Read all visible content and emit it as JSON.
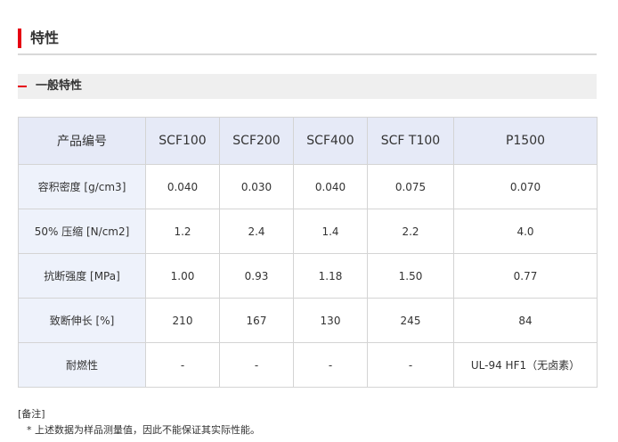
{
  "section": {
    "title": "特性"
  },
  "subsection": {
    "title": "一般特性"
  },
  "table": {
    "headers": [
      "产品编号",
      "SCF100",
      "SCF200",
      "SCF400",
      "SCF T100",
      "P1500"
    ],
    "rows": [
      {
        "label": "容积密度 [g/cm3]",
        "values": [
          "0.040",
          "0.030",
          "0.040",
          "0.075",
          "0.070"
        ]
      },
      {
        "label": "50% 压缩 [N/cm2]",
        "values": [
          "1.2",
          "2.4",
          "1.4",
          "2.2",
          "4.0"
        ]
      },
      {
        "label": "抗断强度 [MPa]",
        "values": [
          "1.00",
          "0.93",
          "1.18",
          "1.50",
          "0.77"
        ]
      },
      {
        "label": "致断伸长 [%]",
        "values": [
          "210",
          "167",
          "130",
          "245",
          "84"
        ]
      },
      {
        "label": "耐燃性",
        "values": [
          "-",
          "-",
          "-",
          "-",
          "UL-94 HF1（无卤素）"
        ]
      }
    ]
  },
  "notes": {
    "label": "[备注]",
    "line": "* 上述数据为样品测量值，因此不能保证其实际性能。"
  },
  "colors": {
    "accent": "#e60012",
    "header_bg": "#e6eaf7",
    "rowhead_bg": "#eef2fb",
    "border": "#d4d4d4",
    "subheader_bg": "#efefef"
  }
}
